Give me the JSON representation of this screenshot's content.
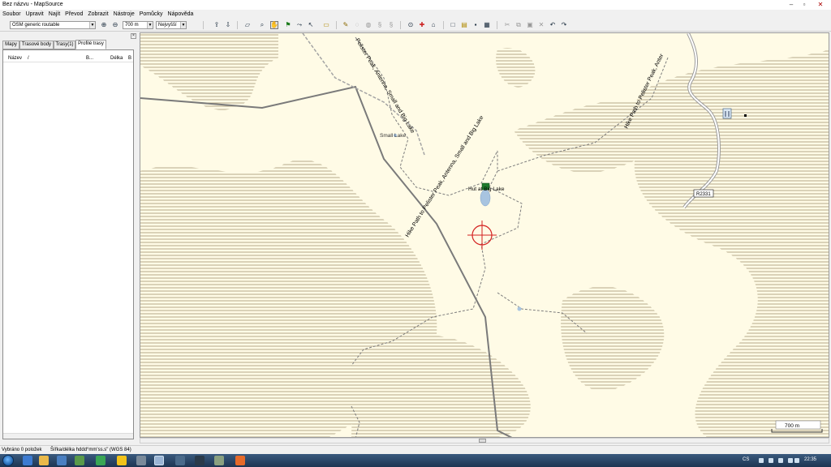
{
  "window": {
    "title": "Bez názvu - MapSource"
  },
  "menu": [
    "Soubor",
    "Upravit",
    "Najít",
    "Převod",
    "Zobrazit",
    "Nástroje",
    "Pomůcky",
    "Nápověda"
  ],
  "toolbar": {
    "map_product": "OSM generic routable",
    "zoom_scale": "700 m",
    "detail_level": "Nejvyšší"
  },
  "left_panel": {
    "tabs": [
      "Mapy",
      "Trasové body",
      "Trasy(1)",
      "Profilé trasy"
    ],
    "active_tab": 3,
    "columns": [
      "Název",
      "/",
      "B...",
      "Délka",
      "B"
    ]
  },
  "map": {
    "labels": {
      "trail_upper": "Pelister Peak, Antenna, Small and Big Lake",
      "trail_lower": "Hike Path to Pelister Peak, Antenna, Small and Big Lake",
      "trail_right": "Hike Path to Pelister Peak, Anter",
      "small_lake": "Small Lake",
      "hut": "Hut at Big Lake",
      "road_shield": "R2331",
      "scale": "700 m"
    },
    "colors": {
      "background": "#fffbe6",
      "hatch": "#b5a98a",
      "road": "#7a7a7a",
      "trail": "#7d7d7d",
      "water": "#a8c4e0",
      "cursor": "#d32020",
      "hut": "#1e7a2c"
    }
  },
  "status": {
    "selected": "Vybráno 0 položek",
    "coords_format": "Šířka/délka hddd°mm'ss.s\" (WGS 84)"
  },
  "taskbar": {
    "language": "CS",
    "clock": "22:35"
  },
  "icons": {
    "close": "close-icon",
    "maximize": "maximize-icon",
    "minimize": "minimize-icon"
  }
}
